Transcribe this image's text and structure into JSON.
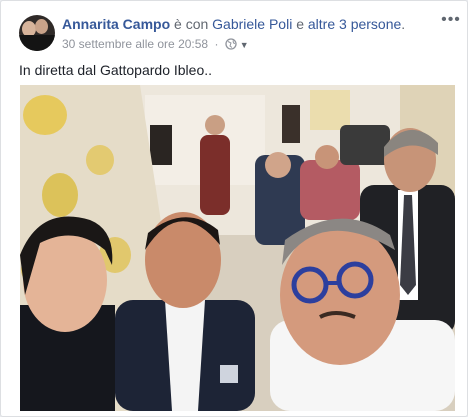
{
  "post": {
    "author": "Annarita Campo",
    "with_text": "è con",
    "tagged_person": "Gabriele Poli",
    "and_text": "e",
    "others": "altre 3 persone",
    "suffix": ".",
    "timestamp": "30 settembre alle ore 20:58",
    "separator": "·",
    "privacy_icon": "globe-icon",
    "more_icon": "more-options-icon",
    "body_text": "In diretta dal Gattopardo Ibleo..",
    "photo": "selfie-group-photo",
    "colors": {
      "link": "#365899",
      "meta": "#90949c",
      "text": "#1d2129"
    }
  }
}
